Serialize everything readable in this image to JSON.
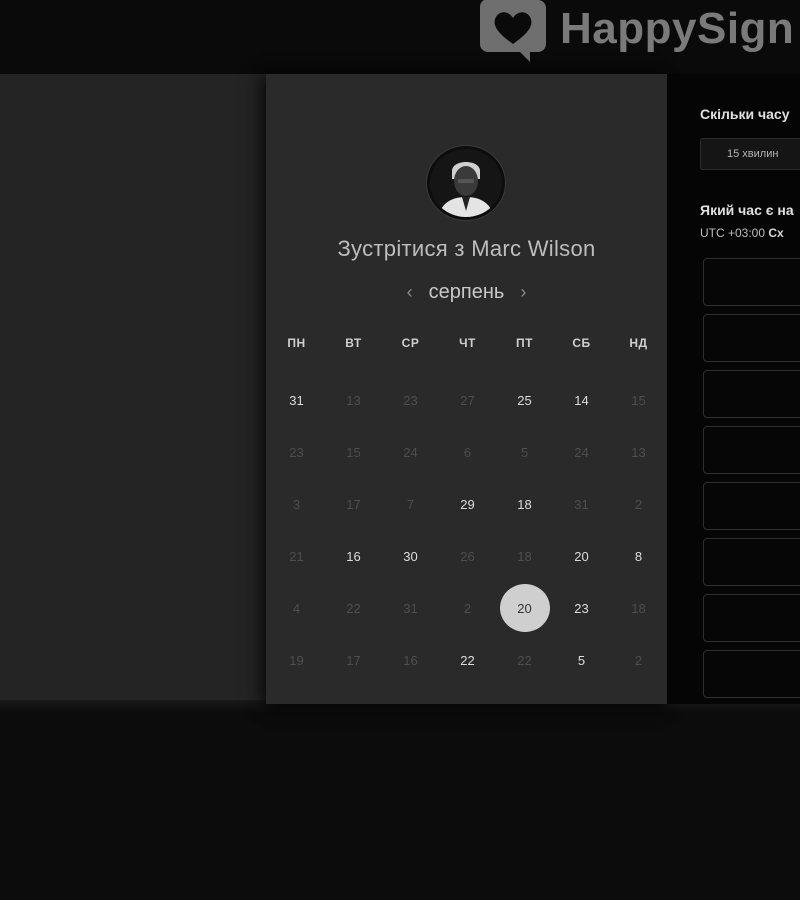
{
  "brand": {
    "logo_text": "HappySign"
  },
  "booking": {
    "avatar_icon": "user-avatar",
    "title_prefix": "Зустрітися з",
    "host_name": "Marc Wilson",
    "month": "серпень",
    "prev_icon": "chevron-left-icon",
    "next_icon": "chevron-right-icon",
    "weekdays": [
      "ПН",
      "ВТ",
      "СР",
      "ЧТ",
      "ПТ",
      "СБ",
      "НД"
    ],
    "days": [
      {
        "label": "31",
        "available": true
      },
      {
        "label": "13",
        "available": false
      },
      {
        "label": "23",
        "available": false
      },
      {
        "label": "27",
        "available": false
      },
      {
        "label": "25",
        "available": true
      },
      {
        "label": "14",
        "available": true
      },
      {
        "label": "15",
        "available": false
      },
      {
        "label": "23",
        "available": false
      },
      {
        "label": "15",
        "available": false
      },
      {
        "label": "24",
        "available": false
      },
      {
        "label": "6",
        "available": false
      },
      {
        "label": "5",
        "available": false
      },
      {
        "label": "24",
        "available": false
      },
      {
        "label": "13",
        "available": false
      },
      {
        "label": "3",
        "available": false
      },
      {
        "label": "17",
        "available": false
      },
      {
        "label": "7",
        "available": false
      },
      {
        "label": "29",
        "available": true
      },
      {
        "label": "18",
        "available": true
      },
      {
        "label": "31",
        "available": false
      },
      {
        "label": "2",
        "available": false
      },
      {
        "label": "21",
        "available": false
      },
      {
        "label": "16",
        "available": true
      },
      {
        "label": "30",
        "available": true
      },
      {
        "label": "26",
        "available": false
      },
      {
        "label": "18",
        "available": false
      },
      {
        "label": "20",
        "available": true
      },
      {
        "label": "8",
        "available": true
      },
      {
        "label": "4",
        "available": false
      },
      {
        "label": "22",
        "available": false
      },
      {
        "label": "31",
        "available": false
      },
      {
        "label": "2",
        "available": false
      },
      {
        "label": "20",
        "available": true,
        "selected": true
      },
      {
        "label": "23",
        "available": true
      },
      {
        "label": "18",
        "available": false
      },
      {
        "label": "19",
        "available": false
      },
      {
        "label": "17",
        "available": false
      },
      {
        "label": "16",
        "available": false
      },
      {
        "label": "22",
        "available": true
      },
      {
        "label": "22",
        "available": false
      },
      {
        "label": "5",
        "available": true
      },
      {
        "label": "2",
        "available": false
      }
    ]
  },
  "right": {
    "question_duration": "Скільки часу",
    "duration_value": "15 хвилин",
    "question_time": "Який час є на",
    "timezone_prefix": "UTC +03:00",
    "timezone_suffix": "Сх",
    "slot_count": 8
  },
  "colors": {
    "background": "#0c0c0c",
    "panel": "#2a2a2a",
    "selected_day": "#cfcfcf"
  }
}
